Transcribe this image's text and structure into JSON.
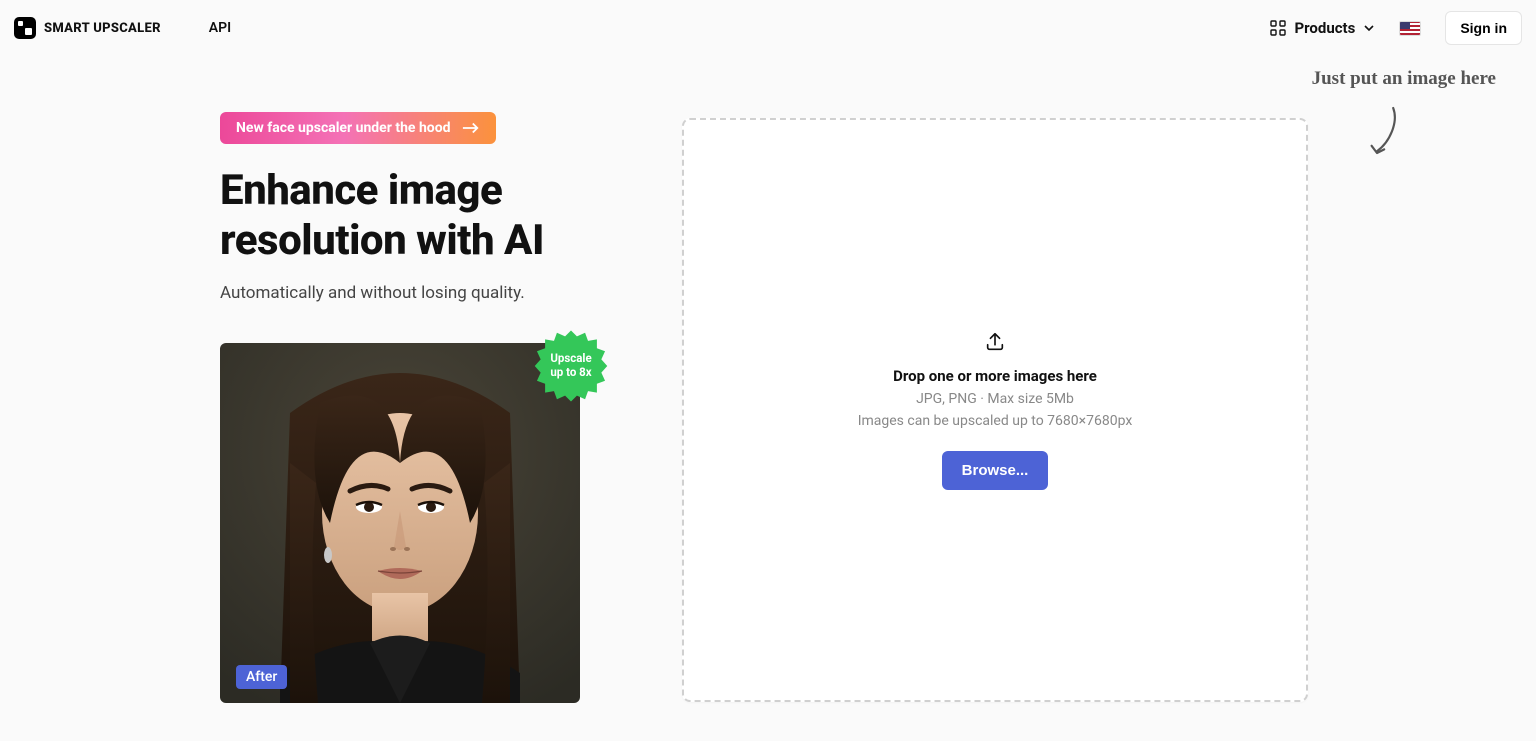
{
  "header": {
    "brand": "SMART UPSCALER",
    "api_link": "API",
    "products_link": "Products",
    "signin": "Sign in"
  },
  "announce": {
    "label": "New face upscaler under the hood"
  },
  "hero": {
    "title": "Enhance image resolution with AI",
    "subtitle": "Automatically and without losing quality."
  },
  "example": {
    "after_label": "After",
    "badge_line1": "Upscale",
    "badge_line2": "up to 8x"
  },
  "callout": {
    "text": "Just put an image here"
  },
  "dropzone": {
    "title": "Drop one or more images here",
    "sub1": "JPG, PNG · Max size 5Mb",
    "sub2": "Images can be upscaled up to 7680×7680px",
    "browse": "Browse..."
  }
}
